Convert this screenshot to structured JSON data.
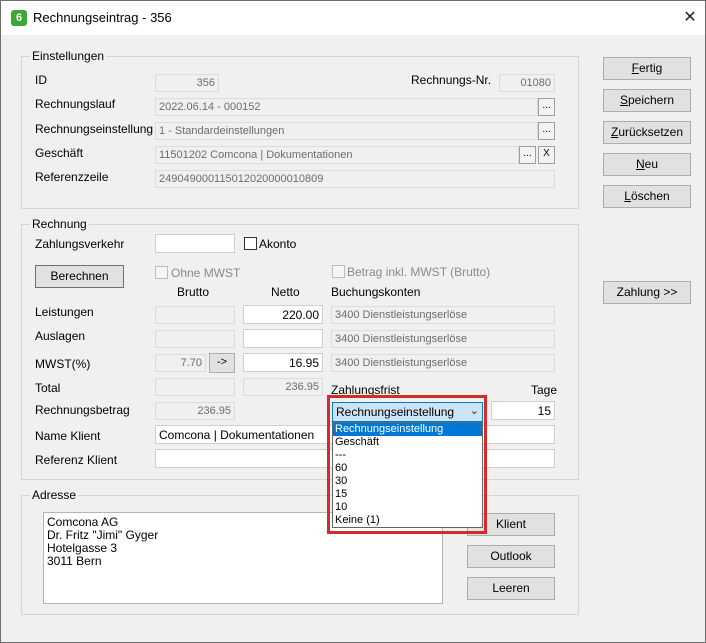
{
  "window": {
    "title": "Rechnungseintrag - 356",
    "app_icon_glyph": "6",
    "close_glyph": "✕"
  },
  "einstellungen": {
    "title": "Einstellungen",
    "id_label": "ID",
    "id_value": "356",
    "rnr_label": "Rechnungs-Nr.",
    "rnr_value": "01080",
    "lauf_label": "Rechnungslauf",
    "lauf_value": "2022.06.14 - 000152",
    "einst_label": "Rechnungseinstellung",
    "einst_value": "1 -  Standardeinstellungen",
    "geschaeft_label": "Geschäft",
    "geschaeft_value": "11501202  Comcona | Dokumentationen",
    "ref_label": "Referenzzeile",
    "ref_value": "249049000115012020000010809",
    "browse": "...",
    "clear": "X"
  },
  "rechnung": {
    "title": "Rechnung",
    "zahlungsverkehr_label": "Zahlungsverkehr",
    "zahlungsverkehr_value": "",
    "akonto_label": "Akonto",
    "berechnen": "Berechnen",
    "ohne_mwst": "Ohne MWST",
    "betrag_inkl": "Betrag inkl. MWST (Brutto)",
    "col_brutto": "Brutto",
    "col_netto": "Netto",
    "col_konten": "Buchungskonten",
    "leistungen_label": "Leistungen",
    "leistungen_brutto": "",
    "leistungen_netto": "220.00",
    "leistungen_konto": "3400  Dienstleistungserlöse",
    "auslagen_label": "Auslagen",
    "auslagen_brutto": "",
    "auslagen_netto": "",
    "auslagen_konto": "3400  Dienstleistungserlöse",
    "mwst_label": "MWST(%)",
    "mwst_brutto": "7.70",
    "mwst_arrow": "->",
    "mwst_netto": "16.95",
    "mwst_konto": "3400  Dienstleistungserlöse",
    "total_label": "Total",
    "total_brutto": "",
    "total_netto": "236.95",
    "betrag_label": "Rechnungsbetrag",
    "betrag_value": "236.95",
    "zahlungsfrist_label": "Zahlungsfrist",
    "tage_label": "Tage",
    "tage_value": "15",
    "name_klient_label": "Name Klient",
    "name_klient_value": "Comcona | Dokumentationen",
    "ref_klient_label": "Referenz Klient",
    "ref_klient_value": "",
    "combo_value": "Rechnungseinstellung",
    "options": [
      "Rechnungseinstellung",
      "Geschäft",
      "---",
      "60",
      "30",
      "15",
      "10",
      "Keine (1)"
    ]
  },
  "adresse": {
    "title": "Adresse",
    "lines": [
      "Comcona AG",
      "Dr. Fritz \"Jimi\" Gyger",
      "Hotelgasse 3",
      "3011 Bern"
    ],
    "klient": "Klient",
    "outlook": "Outlook",
    "leeren": "Leeren"
  },
  "actions": {
    "fertig": {
      "a": "F",
      "b": "ertig"
    },
    "speichern": {
      "a": "S",
      "b": "peichern"
    },
    "zuruecksetzen": {
      "a": "Z",
      "b": "urücksetzen"
    },
    "neu": {
      "a": "N",
      "b": "eu"
    },
    "loeschen": {
      "a": "L",
      "b": "öschen"
    },
    "zahlung": "Zahlung >>"
  }
}
